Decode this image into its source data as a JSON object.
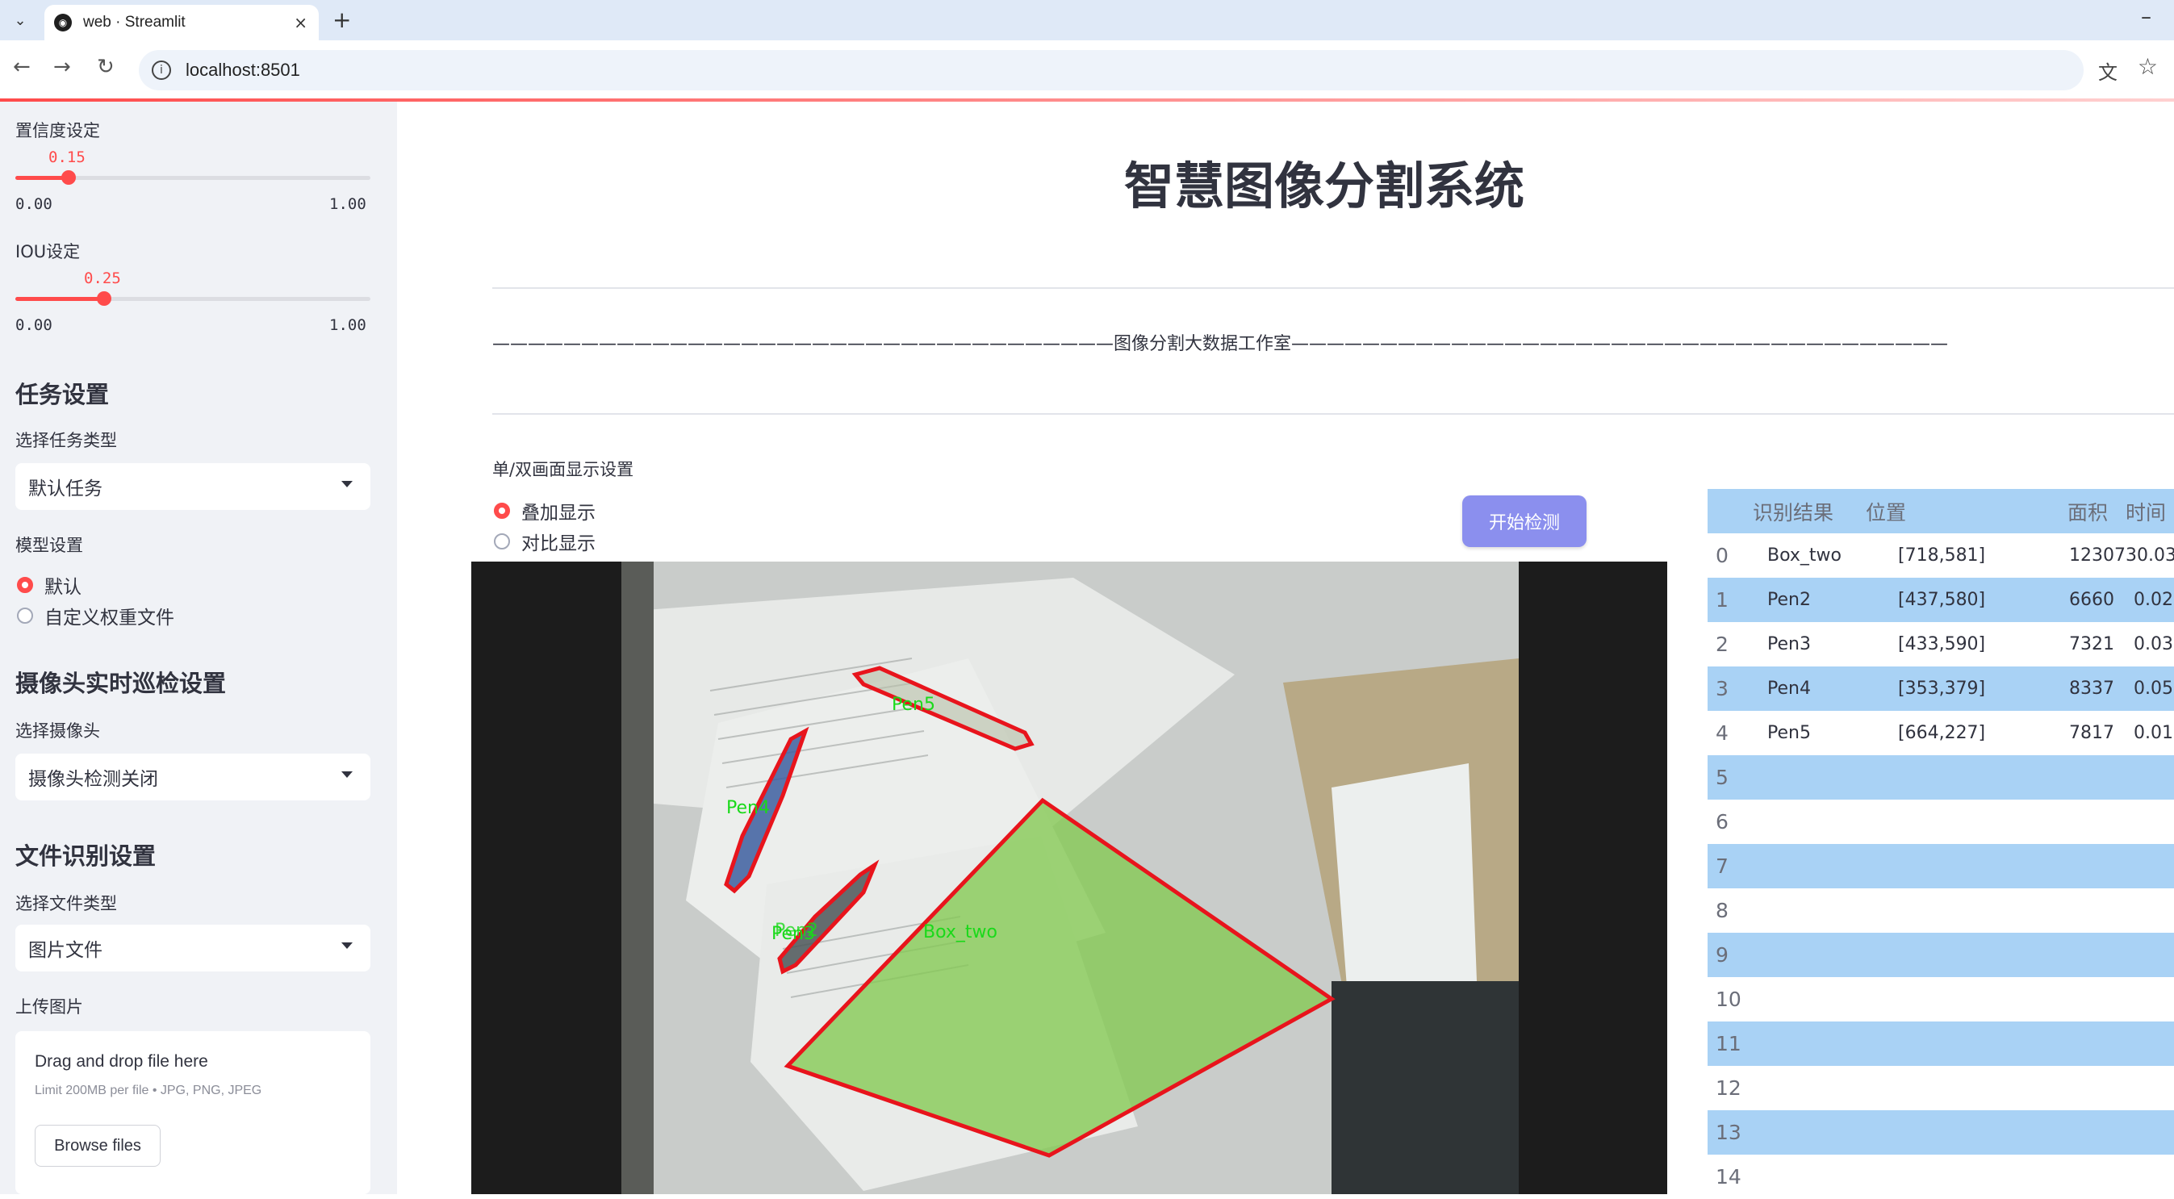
{
  "browser": {
    "tab_title": "web · Streamlit",
    "url": "localhost:8501",
    "new_tab": "+",
    "close": "×",
    "minimize": "–"
  },
  "sidebar": {
    "confidence": {
      "label": "置信度设定",
      "value": "0.15",
      "min": "0.00",
      "max": "1.00",
      "fraction": 0.15
    },
    "iou": {
      "label": "IOU设定",
      "value": "0.25",
      "min": "0.00",
      "max": "1.00",
      "fraction": 0.25
    },
    "task_heading": "任务设置",
    "task_type_label": "选择任务类型",
    "task_type_value": "默认任务",
    "model_label": "模型设置",
    "model_options": [
      "默认",
      "自定义权重文件"
    ],
    "camera_heading": "摄像头实时巡检设置",
    "camera_label": "选择摄像头",
    "camera_value": "摄像头检测关闭",
    "file_heading": "文件识别设置",
    "file_type_label": "选择文件类型",
    "file_type_value": "图片文件",
    "upload_label": "上传图片",
    "upload_main": "Drag and drop file here",
    "upload_sub": "Limit 200MB per file • JPG, PNG, JPEG",
    "browse_button": "Browse files"
  },
  "main": {
    "title": "智慧图像分割系统",
    "subtitle_line": "———————————————————————————————————图像分割大数据工作室—————————————————————————————————————",
    "display_mode_label": "单/双画面显示设置",
    "display_options": [
      "叠加显示",
      "对比显示"
    ],
    "start_button": "开始检测"
  },
  "detections": [
    {
      "label": "Pen5"
    },
    {
      "label": "Pen4"
    },
    {
      "label": "Pen3"
    },
    {
      "label": "Pen2"
    },
    {
      "label": "Box_two"
    }
  ],
  "table": {
    "headers": [
      "",
      "识别结果",
      "位置",
      "面积",
      "时间"
    ],
    "rows": [
      [
        "0",
        "Box_two",
        "[718,581]",
        "1230730.03",
        ""
      ],
      [
        "1",
        "Pen2",
        "[437,580]",
        "6660",
        "0.02"
      ],
      [
        "2",
        "Pen3",
        "[433,590]",
        "7321",
        "0.03"
      ],
      [
        "3",
        "Pen4",
        "[353,379]",
        "8337",
        "0.05"
      ],
      [
        "4",
        "Pen5",
        "[664,227]",
        "7817",
        "0.01"
      ],
      [
        "5",
        "",
        "",
        "",
        ""
      ],
      [
        "6",
        "",
        "",
        "",
        ""
      ],
      [
        "7",
        "",
        "",
        "",
        ""
      ],
      [
        "8",
        "",
        "",
        "",
        ""
      ],
      [
        "9",
        "",
        "",
        "",
        ""
      ],
      [
        "10",
        "",
        "",
        "",
        ""
      ],
      [
        "11",
        "",
        "",
        "",
        ""
      ],
      [
        "12",
        "",
        "",
        "",
        ""
      ],
      [
        "13",
        "",
        "",
        "",
        ""
      ],
      [
        "14",
        "",
        "",
        "",
        ""
      ]
    ]
  },
  "colors": {
    "accent": "#ff4b4b",
    "button": "#8b8fee",
    "table_header": "#a9d2f5",
    "table_stripe": "#a9d2f5"
  }
}
